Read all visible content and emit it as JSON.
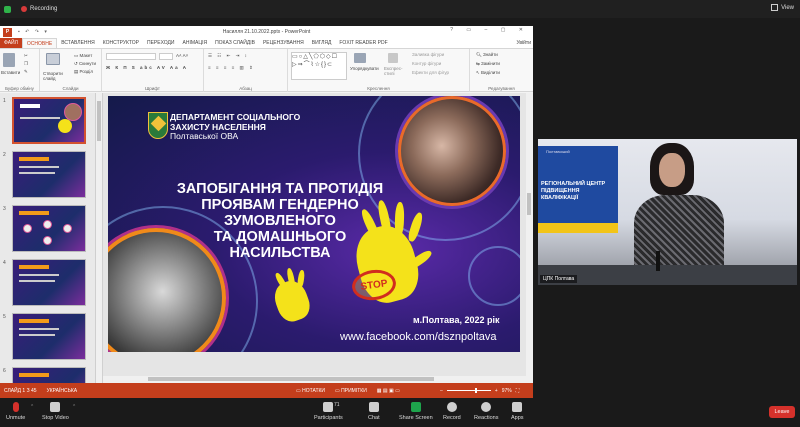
{
  "zoom_top": {
    "recording": "Recording",
    "view": "View"
  },
  "ppt": {
    "window_title": "Насилля 21.10.2022.pptx - PowerPoint",
    "tabs": [
      "ФАЙЛ",
      "ОСНОВНЕ",
      "ВСТАВЛЕННЯ",
      "КОНСТРУКТОР",
      "ПЕРЕХОДИ",
      "АНІМАЦІЯ",
      "ПОКАЗ СЛАЙДІВ",
      "РЕЦЕНЗУВАННЯ",
      "ВИГЛЯД",
      "FOXIT READER PDF"
    ],
    "user": "Увійти",
    "ribbon": {
      "paste": "Вставити",
      "clipboard": "Буфер обміну",
      "new_slide": "Створити слайд",
      "layout": "Макет",
      "reset": "Скинути",
      "section": "Розділ",
      "slides": "Слайди",
      "font": "Шрифт",
      "paragraph": "Абзац",
      "arrange": "Упорядкувати",
      "quick_styles": "Експрес-стилі",
      "fill": "Заливка фігури",
      "outline": "Контур фігури",
      "effects": "Ефекти для фігур",
      "drawing": "Креслення",
      "find": "Знайти",
      "replace": "Замінити",
      "select": "Виділити",
      "editing": "Редагування"
    },
    "thumb_numbers": [
      "1",
      "2",
      "3",
      "4",
      "5",
      "6"
    ],
    "slide": {
      "dept_line1": "ДЕПАРТАМЕНТ СОЦІАЛЬНОГО",
      "dept_line2": "ЗАХИСТУ НАСЕЛЕННЯ",
      "dept_line3": "Полтавської ОВА",
      "title_line1": "ЗАПОБІГАННЯ ТА ПРОТИДІЯ",
      "title_line2": "ПРОЯВАМ ГЕНДЕРНО ЗУМОВЛЕНОГО",
      "title_line3": "ТА ДОМАШНЬОГО",
      "title_line4": "НАСИЛЬСТВА",
      "stop": "STOP",
      "city": "м.Полтава, 2022 рік",
      "link": "www.facebook.com/dsznpoltava"
    },
    "status": {
      "slide_count": "СЛАЙД 1 З 45",
      "language": "УКРАЇНСЬКА",
      "notes": "НОТАТКИ",
      "comments": "ПРИМІТКИ",
      "zoom": "97%",
      "zoom_fraction": 0.63
    }
  },
  "video": {
    "banner_title": "Полтавський",
    "banner_text_1": "РЕГІОНАЛЬНИЙ ЦЕНТР",
    "banner_text_2": "ПІДВИЩЕННЯ КВАЛІФІКАЦІЇ",
    "participant_name": "ЦПК Полтава"
  },
  "zoom_bar": {
    "unmute": "Unmute",
    "stop_video": "Stop Video",
    "participants": "Participants",
    "participants_count": "71",
    "chat": "Chat",
    "share_screen": "Share Screen",
    "record": "Record",
    "reactions": "Reactions",
    "apps": "Apps",
    "leave": "Leave"
  },
  "colors": {
    "ppt_accent": "#c43e1c",
    "share_green": "#1ea44c",
    "leave_red": "#d5312b"
  }
}
